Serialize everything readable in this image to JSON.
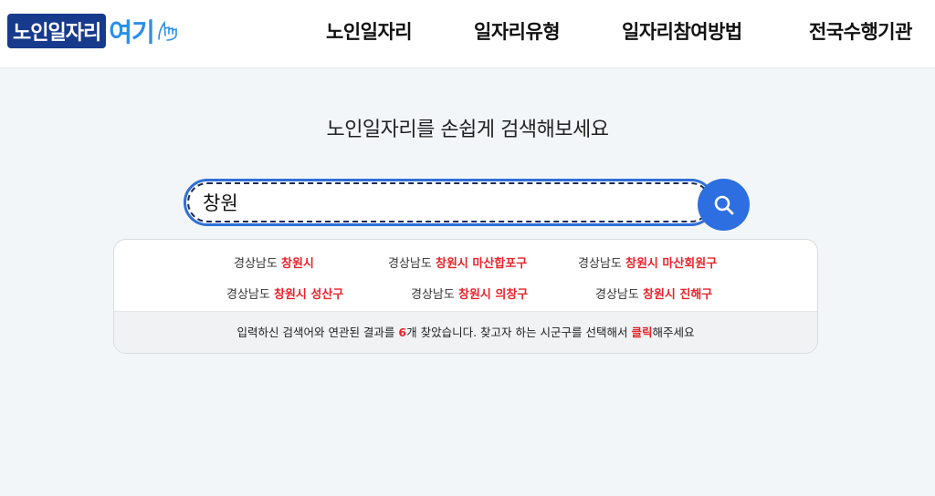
{
  "header": {
    "logo": {
      "part1": "노인일자리",
      "part2": "여기"
    },
    "nav": [
      {
        "label": "노인일자리"
      },
      {
        "label": "일자리유형"
      },
      {
        "label": "일자리참여방법"
      },
      {
        "label": "전국수행기관"
      }
    ]
  },
  "headline": "노인일자리를 손쉽게 검색해보세요",
  "search": {
    "value": "창원"
  },
  "results": [
    {
      "region": "경상남도",
      "city": "창원시"
    },
    {
      "region": "경상남도",
      "city": "창원시 마산합포구"
    },
    {
      "region": "경상남도",
      "city": "창원시 마산회원구"
    },
    {
      "region": "경상남도",
      "city": "창원시 성산구"
    },
    {
      "region": "경상남도",
      "city": "창원시 의창구"
    },
    {
      "region": "경상남도",
      "city": "창원시 진해구"
    }
  ],
  "footer": {
    "before": "입력하신 검색어와 연관된 결과를 ",
    "count": "6",
    "middle": "개 찾았습니다. 찾고자 하는 시군구를 선택해서 ",
    "click": "클릭",
    "after": "해주세요"
  },
  "colors": {
    "accent": "#2d6fe0",
    "highlight": "#e8242a",
    "logo": "#173a8c"
  }
}
